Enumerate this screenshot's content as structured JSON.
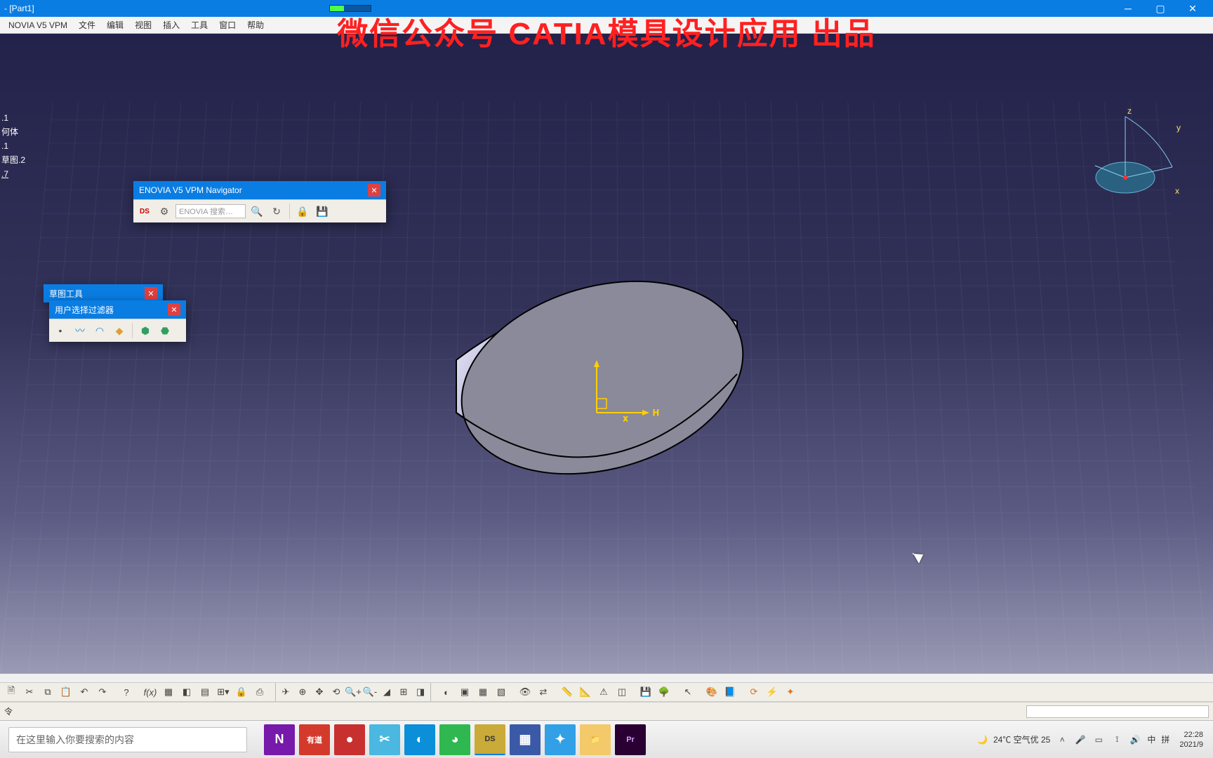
{
  "title": "- [Part1]",
  "watermark": "微信公众号 CATIA模具设计应用 出品",
  "menus": [
    "NOVIA V5 VPM",
    "文件",
    "编辑",
    "视图",
    "插入",
    "工具",
    "窗口",
    "帮助"
  ],
  "spectree": [
    ".1",
    "何体",
    ".1",
    "草图.2",
    ".7"
  ],
  "toolwin1": {
    "title": "ENOVIA V5 VPM Navigator",
    "search": "ENOVIA 搜索…"
  },
  "toolwin2": {
    "title": "草图工具"
  },
  "toolwin3": {
    "title": "用户选择过滤器"
  },
  "statusbar": {
    "prompt": "令"
  },
  "compass_axes": {
    "x": "x",
    "y": "y",
    "z": "z"
  },
  "model_axes": {
    "h": "H",
    "x": "x"
  },
  "taskbar": {
    "search_placeholder": "在这里输入你要搜索的内容",
    "weather": "24℃  空气优 25",
    "ime1": "中",
    "ime2": "拼",
    "time": "22:28",
    "date": "2021/9"
  },
  "apps": [
    {
      "name": "onenote",
      "bg": "#7719aa",
      "fg": "#fff",
      "txt": "N"
    },
    {
      "name": "youdao",
      "bg": "#d33a2c",
      "fg": "#fff",
      "txt": "有道"
    },
    {
      "name": "red-circle",
      "bg": "#c83030",
      "fg": "#fff",
      "txt": "●"
    },
    {
      "name": "snip",
      "bg": "#4ab8e0",
      "fg": "#fff",
      "txt": "✂"
    },
    {
      "name": "edge",
      "bg": "#0a8fd8",
      "fg": "#fff",
      "txt": "◐"
    },
    {
      "name": "wechat",
      "bg": "#2fb84f",
      "fg": "#fff",
      "txt": "◕"
    },
    {
      "name": "catia",
      "bg": "#caaa38",
      "fg": "#333",
      "txt": "DS"
    },
    {
      "name": "imaging",
      "bg": "#3a5aa8",
      "fg": "#fff",
      "txt": "▦"
    },
    {
      "name": "qq",
      "bg": "#32a0e6",
      "fg": "#fff",
      "txt": "✦"
    },
    {
      "name": "explorer",
      "bg": "#f3c96a",
      "fg": "#5a4a10",
      "txt": "📁"
    },
    {
      "name": "premiere",
      "bg": "#2a0033",
      "fg": "#d89cff",
      "txt": "Pr"
    }
  ]
}
